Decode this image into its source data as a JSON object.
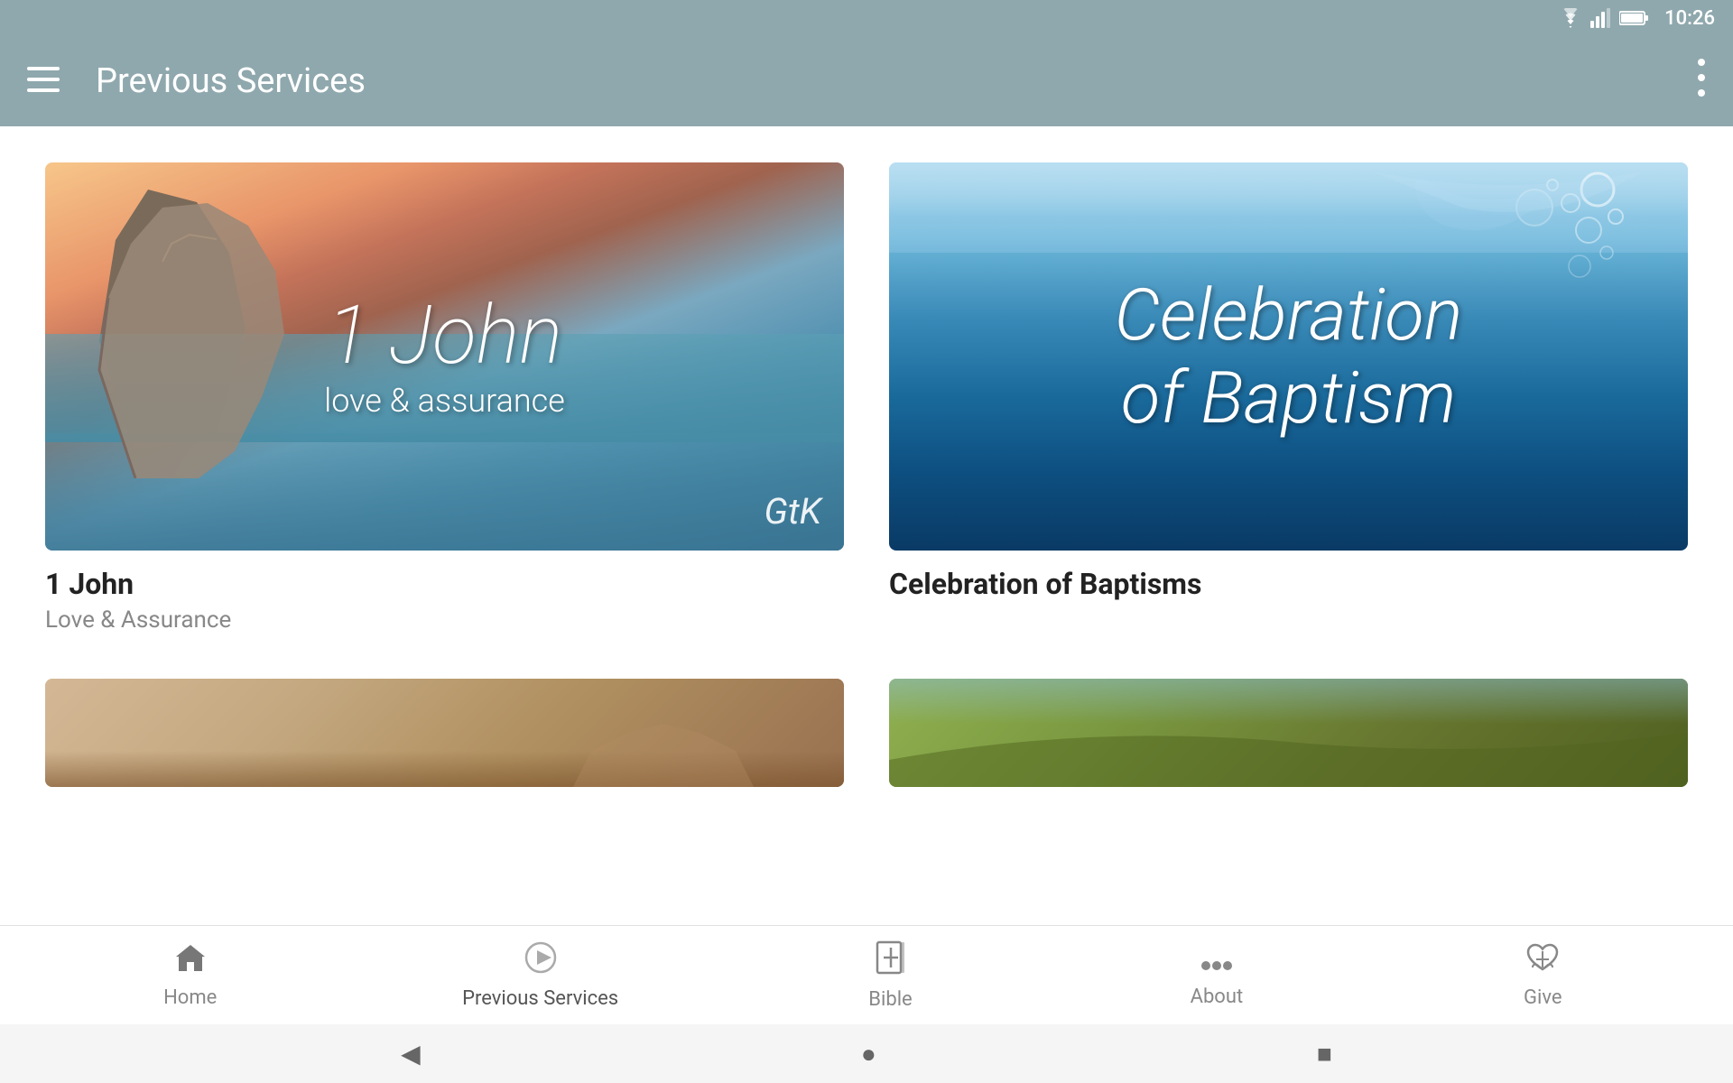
{
  "statusBar": {
    "time": "10:26",
    "wifiIcon": "wifi",
    "signalIcon": "signal",
    "batteryIcon": "battery"
  },
  "appBar": {
    "title": "Previous Services",
    "menuIcon": "hamburger",
    "moreIcon": "more-vertical"
  },
  "cards": [
    {
      "id": "1john",
      "titleMain": "1 John",
      "titleSub": "love & assurance",
      "logo": "GtK",
      "cardTitle": "1 John",
      "cardSubtitle": "Love & Assurance"
    },
    {
      "id": "baptism",
      "titleMain": "Celebration\nof Baptism",
      "cardTitle": "Celebration of Baptisms",
      "cardSubtitle": ""
    }
  ],
  "bottomNav": [
    {
      "id": "home",
      "label": "Home",
      "icon": "⌂",
      "active": false
    },
    {
      "id": "previous-services",
      "label": "Previous Services",
      "icon": "▷",
      "active": true
    },
    {
      "id": "bible",
      "label": "Bible",
      "icon": "✞",
      "active": false
    },
    {
      "id": "about",
      "label": "About",
      "icon": "···",
      "active": false
    },
    {
      "id": "give",
      "label": "Give",
      "icon": "♡",
      "active": false
    }
  ],
  "sysNav": {
    "back": "◀",
    "home": "●",
    "recent": "■"
  }
}
